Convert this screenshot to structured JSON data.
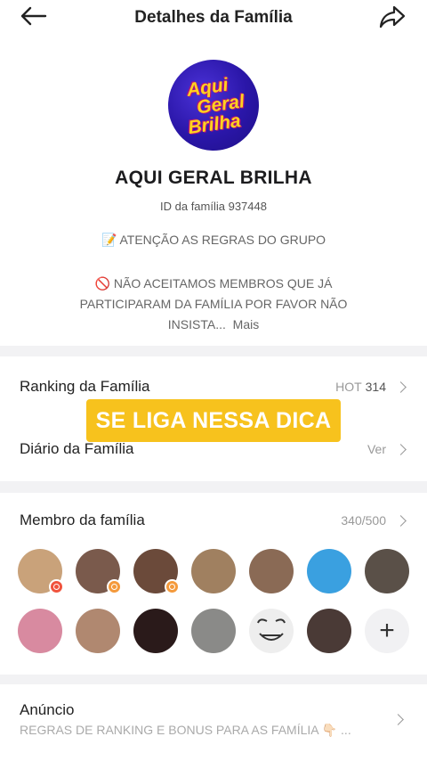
{
  "header": {
    "title": "Detalhes da Família"
  },
  "family": {
    "logo_lines": [
      "Aqui",
      "Geral",
      "Brilha"
    ],
    "name": "AQUI GERAL BRILHA",
    "id_text": "ID da família 937448",
    "notice": "📝 ATENÇÃO AS REGRAS DO GRUPO",
    "desc_line1": "🚫 NÃO ACEITAMOS MEMBROS QUE JÁ",
    "desc_line2": "PARTICIPARAM  DA FAMÍLIA POR FAVOR NÃO",
    "desc_line3": "INSISTA...",
    "more": "Mais"
  },
  "ranking": {
    "label": "Ranking da Família",
    "hot_label": "HOT",
    "hot_value": "314"
  },
  "diary": {
    "label": "Diário da Família",
    "action": "Ver"
  },
  "overlay": {
    "text": "SE LIGA NESSA DICA"
  },
  "members": {
    "label": "Membro da família",
    "count": "340/500",
    "avatar_colors": [
      "#c9a27a",
      "#7a5a4c",
      "#6b4a3a",
      "#a08060",
      "#8a6a55",
      "#3aa0e0",
      "#5a5048",
      "#d88aa0",
      "#b08870",
      "#2a1a1a",
      "#8a8a88",
      "#eeeeee",
      "#4a3a36"
    ]
  },
  "announcement": {
    "title": "Anúncio",
    "text": "REGRAS DE RANKING E BONUS PARA AS FAMÍLIA 👇🏻 ..."
  }
}
